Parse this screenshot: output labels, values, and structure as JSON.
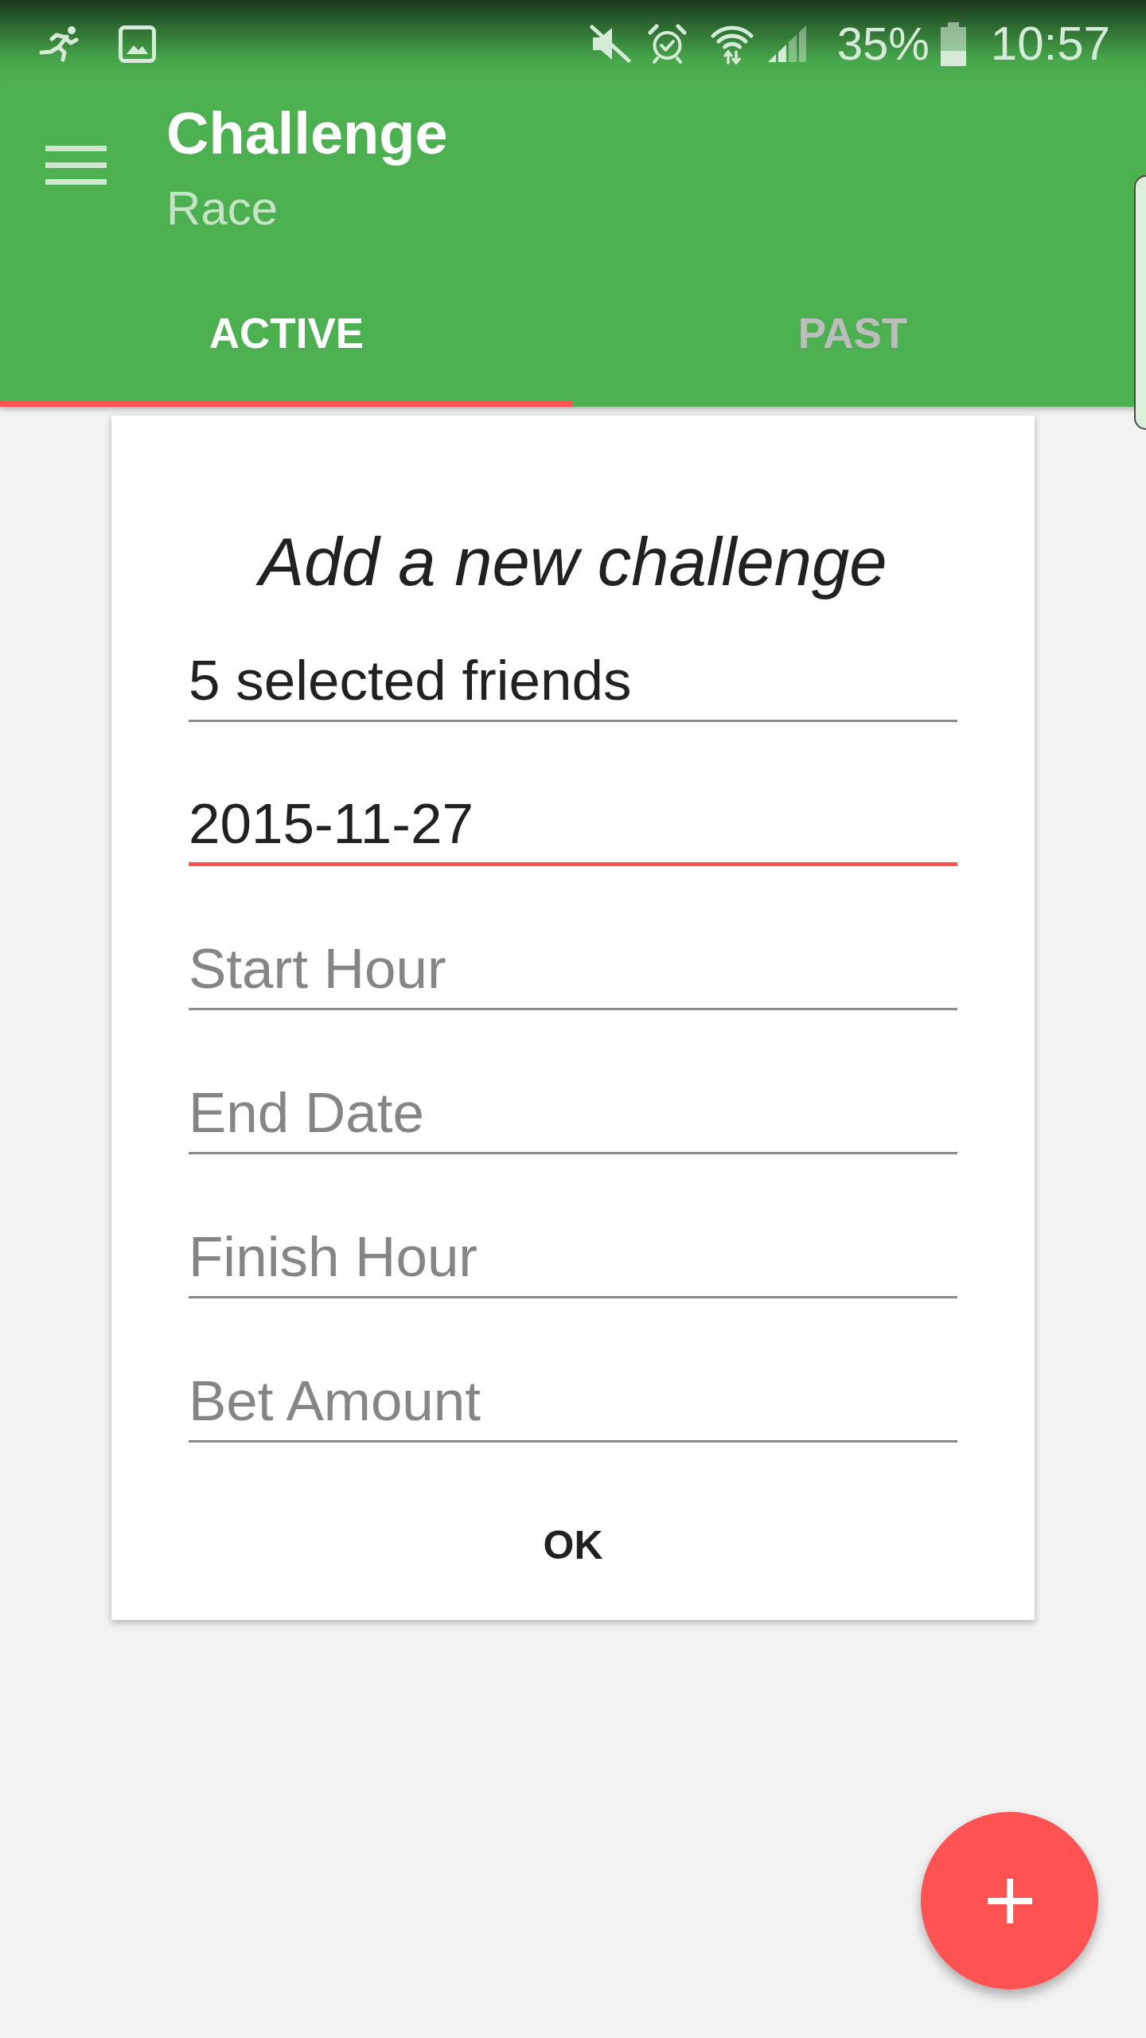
{
  "status_bar": {
    "battery": "35%",
    "time": "10:57"
  },
  "app_bar": {
    "title": "Challenge",
    "subtitle": "Race"
  },
  "tabs": [
    {
      "label": "ACTIVE",
      "selected": true
    },
    {
      "label": "PAST",
      "selected": false
    }
  ],
  "dialog": {
    "title": "Add a new challenge",
    "fields": [
      {
        "value": "5 selected friends",
        "focused": false
      },
      {
        "value": "2015-11-27",
        "focused": true
      },
      {
        "placeholder": "Start Hour",
        "focused": false
      },
      {
        "placeholder": "End Date",
        "focused": false
      },
      {
        "placeholder": "Finish Hour",
        "focused": false
      },
      {
        "placeholder": "Bet Amount",
        "focused": false
      }
    ],
    "button": "OK"
  }
}
